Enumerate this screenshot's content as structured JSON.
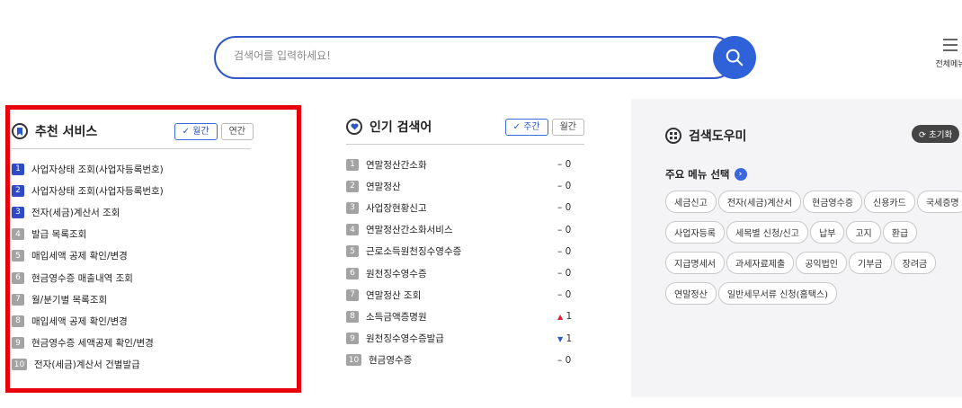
{
  "search": {
    "placeholder": "검색어를 입력하세요!"
  },
  "menu": {
    "label": "전체메뉴"
  },
  "recommend": {
    "title": "추천 서비스",
    "toggles": [
      "월간",
      "연간"
    ],
    "active_toggle": "월간",
    "items": [
      {
        "num": "1",
        "label": "사업자상태 조회(사업자등록번호)"
      },
      {
        "num": "2",
        "label": "사업자상태 조회(사업자등록번호)"
      },
      {
        "num": "3",
        "label": "전자(세금)계산서 조회"
      },
      {
        "num": "4",
        "label": "발급 목록조회"
      },
      {
        "num": "5",
        "label": "매입세액 공제 확인/변경"
      },
      {
        "num": "6",
        "label": "현금영수증 매출내역 조회"
      },
      {
        "num": "7",
        "label": "월/분기별 목록조회"
      },
      {
        "num": "8",
        "label": "매입세액 공제 확인/변경"
      },
      {
        "num": "9",
        "label": "현금영수증 세액공제 확인/변경"
      },
      {
        "num": "10",
        "label": "전자(세금)계산서 건별발급"
      }
    ]
  },
  "popular": {
    "title": "인기 검색어",
    "toggles": [
      "주간",
      "월간"
    ],
    "active_toggle": "주간",
    "items": [
      {
        "num": "1",
        "label": "연말정산간소화",
        "trend": "–",
        "change": "0"
      },
      {
        "num": "2",
        "label": "연말정산",
        "trend": "–",
        "change": "0"
      },
      {
        "num": "3",
        "label": "사업장현황신고",
        "trend": "–",
        "change": "0"
      },
      {
        "num": "4",
        "label": "연말정산간소화서비스",
        "trend": "–",
        "change": "0"
      },
      {
        "num": "5",
        "label": "근로소득원천징수영수증",
        "trend": "–",
        "change": "0"
      },
      {
        "num": "6",
        "label": "원천징수영수증",
        "trend": "–",
        "change": "0"
      },
      {
        "num": "7",
        "label": "연말정산 조회",
        "trend": "–",
        "change": "0"
      },
      {
        "num": "8",
        "label": "소득금액증명원",
        "trend": "▲",
        "change": "1"
      },
      {
        "num": "9",
        "label": "원천징수영수증발급",
        "trend": "▼",
        "change": "1"
      },
      {
        "num": "10",
        "label": "현금영수증",
        "trend": "–",
        "change": "0"
      }
    ]
  },
  "helper": {
    "title": "검색도우미",
    "reset_label": "초기화",
    "subtitle": "주요 메뉴 선택",
    "chips": [
      "세금신고",
      "전자(세금)계산서",
      "현금영수증",
      "신용카드",
      "국세증명",
      "사업자등록",
      "세목별 신청/신고",
      "납부",
      "고지",
      "환급",
      "지급명세서",
      "과세자료제출",
      "공익법인",
      "기부금",
      "장려금",
      "연말정산",
      "일반세무서류 신청(홈택스)"
    ]
  },
  "colors": {
    "accent": "#2f57c9",
    "highlight_border": "#e8000b",
    "up": "#e0242c"
  }
}
